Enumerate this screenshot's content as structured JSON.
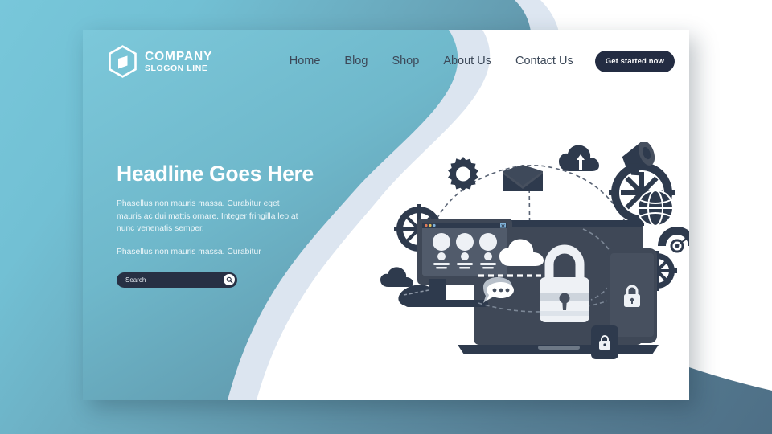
{
  "page": {
    "background_top_left": "#78c7da",
    "background_bottom_right": "#4e6f86",
    "wave_color_light": "#dde6f1",
    "wave_color_white": "#ffffff"
  },
  "card": {
    "background_left": "#6fb3c6",
    "background_right": "#ffffff"
  },
  "header": {
    "logo": {
      "icon": "hexagon-logo-icon",
      "name": "COMPANY",
      "slogan": "SLOGON LINE"
    },
    "nav": [
      {
        "label": "Home",
        "name": "home"
      },
      {
        "label": "Blog",
        "name": "blog"
      },
      {
        "label": "Shop",
        "name": "shop"
      },
      {
        "label": "About Us",
        "name": "about-us"
      },
      {
        "label": "Contact Us",
        "name": "contact-us"
      }
    ],
    "cta": {
      "label": "Get started now",
      "bg": "#232c42",
      "color": "#ffffff"
    }
  },
  "hero": {
    "title": "Headline Goes Here",
    "paragraph_1": "Phasellus non mauris massa.  Curabitur eget mauris ac dui mattis ornare. Integer fringilla leo at nunc venenatis semper.",
    "paragraph_2": "Phasellus non mauris massa.  Curabitur",
    "search": {
      "value": "",
      "placeholder": "Search",
      "button_icon": "search-icon",
      "bg": "#273044"
    }
  },
  "illustration": {
    "title": "cyber-security-devices-illustration",
    "dark_color": "#2e3a4d",
    "mid_color": "#47505f",
    "light_color": "#eef1f5",
    "elements": [
      "gear-icon",
      "envelope-icon",
      "cloud-upload-icon",
      "cog-wheel-icon",
      "megaphone-icon",
      "globe-icon",
      "speedometer-icon",
      "desktop-monitor",
      "browser-window-avatars",
      "laptop",
      "padlock-large-icon",
      "cloud-icon",
      "chat-bubble-icon",
      "tablet-device",
      "padlock-tablet-icon",
      "smartphone-device",
      "padlock-phone-icon",
      "mouse-icon",
      "cloud-small-icon"
    ]
  }
}
